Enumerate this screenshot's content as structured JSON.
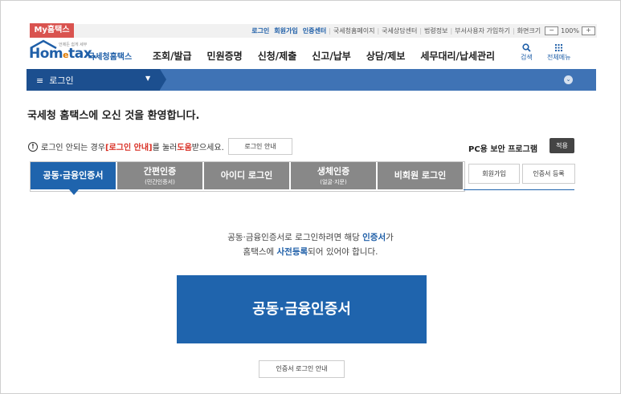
{
  "util": {
    "my_badge": "My홈택스",
    "links": [
      "로그인",
      "회원가입",
      "인증센터",
      "국세청홈페이지",
      "국세상담센터",
      "법령정보",
      "부서사용자 가입하기"
    ],
    "screen_size_label": "화면크기",
    "zoom_minus": "−",
    "zoom_value": "100%",
    "zoom_plus": "+"
  },
  "logo": {
    "main_left": "Hom",
    "main_e": "e",
    "main_right": "tax.",
    "tagline": "언제든 쉽게 세무",
    "sub": "국세청홈택스"
  },
  "nav": {
    "items": [
      "조회/발급",
      "민원증명",
      "신청/제출",
      "신고/납부",
      "상담/제보",
      "세무대리/납세관리"
    ],
    "search_icon_glyph": "🔍",
    "search_label": "검색",
    "menu_icon_glyph": "⠿",
    "menu_label": "전체메뉴"
  },
  "login_bar": {
    "menu_glyph": "≡",
    "label": "로그인",
    "caret": "▼",
    "circle_glyph": "⌄"
  },
  "welcome": "국세청 홈택스에 오신 것을 환영합니다.",
  "notice": {
    "info_glyph": "!",
    "part1": "로그인 안되는 경우 ",
    "red1": "[로그인 안내]",
    "part2": "를 눌러 ",
    "red2": "도움",
    "part3": "받으세요."
  },
  "guide_button": "로그인 안내",
  "pc_security": {
    "label": "PC용 보안 프로그램",
    "apply": "적용"
  },
  "tabs": [
    {
      "title": "공동·금융인증서",
      "sub": ""
    },
    {
      "title": "간편인증",
      "sub": "(민간인증서)"
    },
    {
      "title": "아이디 로그인",
      "sub": ""
    },
    {
      "title": "생체인증",
      "sub": "(얼굴·지문)"
    },
    {
      "title": "비회원 로그인",
      "sub": ""
    }
  ],
  "side_buttons": {
    "signup": "회원가입",
    "cert_register": "인증서 등록"
  },
  "description": {
    "line1_a": "공동·금융인증서로 로그인하려면 해당 ",
    "line1_b": "인증서",
    "line1_c": "가",
    "line2_a": "홈택스에 ",
    "line2_b": "사전등록",
    "line2_c": "되어 있어야 합니다."
  },
  "cert_button": "공동·금융인증서",
  "cert_guide_button": "인증서 로그인 안내"
}
